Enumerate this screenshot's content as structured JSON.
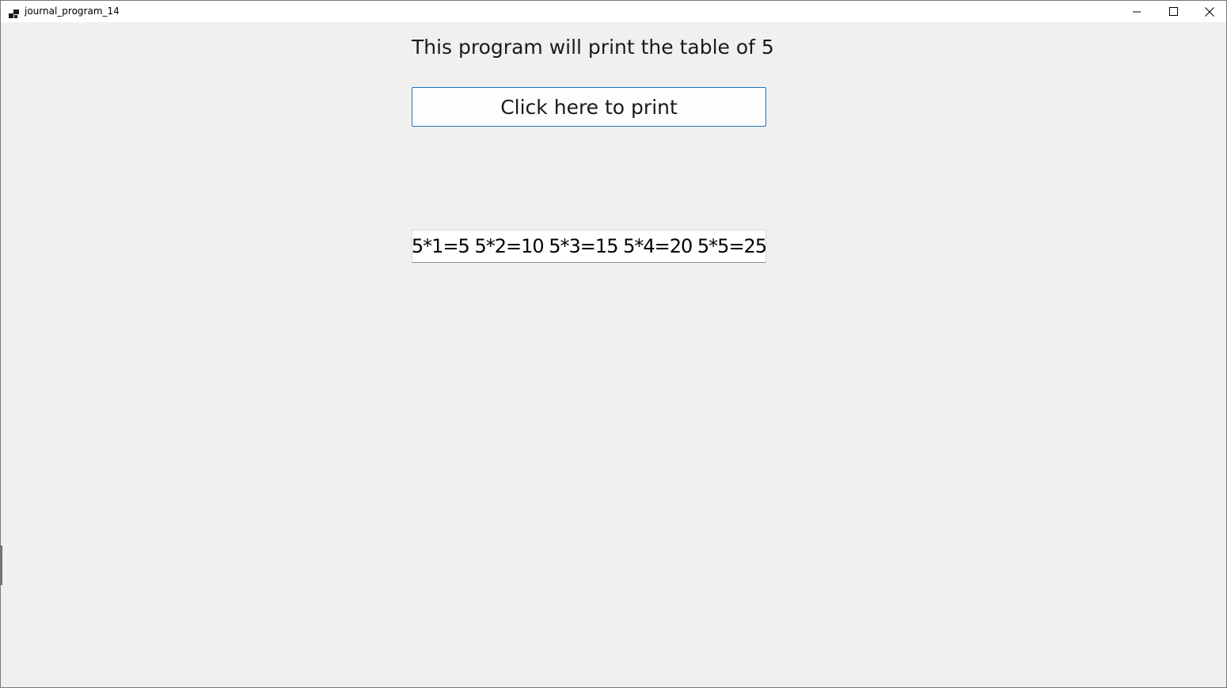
{
  "window": {
    "title": "journal_program_14",
    "icon": "app-window-icon",
    "controls": {
      "minimize": "minimize-icon",
      "maximize": "maximize-icon",
      "close": "close-icon"
    }
  },
  "main": {
    "heading": "This program will print the table of 5",
    "print_button_label": "Click here to print",
    "output_value": "5*1=5 5*2=10 5*3=15 5*4=20 5*5=25"
  },
  "colors": {
    "background": "#f0f0f0",
    "button_border": "#1e73be",
    "titlebar": "#ffffff"
  }
}
